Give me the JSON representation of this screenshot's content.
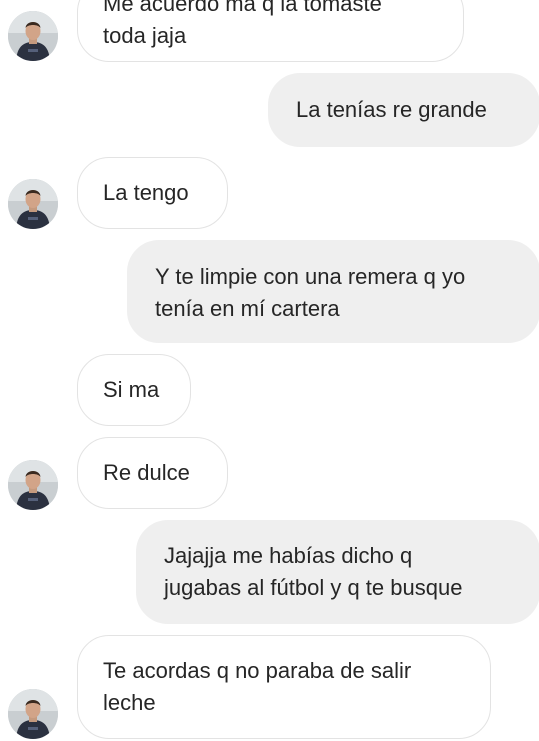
{
  "conversation": {
    "messages": [
      {
        "sender": "them",
        "lines": [
          "Me acuerdo ma q la tomaste",
          "toda jaja"
        ]
      },
      {
        "sender": "me",
        "lines": [
          "La tenías re grande"
        ]
      },
      {
        "sender": "them",
        "lines": [
          "La tengo"
        ]
      },
      {
        "sender": "me",
        "lines": [
          "Y te limpie con una remera q yo",
          "tenía en mí cartera"
        ]
      },
      {
        "sender": "them",
        "lines": [
          "Si ma"
        ]
      },
      {
        "sender": "them",
        "lines": [
          "Re dulce"
        ]
      },
      {
        "sender": "me",
        "lines": [
          "Jajajja me habías dicho q",
          "jugabas al fútbol y q te busque"
        ]
      },
      {
        "sender": "them",
        "lines": [
          "Te acordas q no paraba de salir",
          "leche"
        ]
      }
    ]
  },
  "colors": {
    "incoming_bubble": "#ffffff",
    "incoming_border": "#e3e3e3",
    "outgoing_bubble": "#efefef",
    "text": "#262626"
  },
  "icons": {
    "avatar": "contact-profile-photo-icon"
  }
}
